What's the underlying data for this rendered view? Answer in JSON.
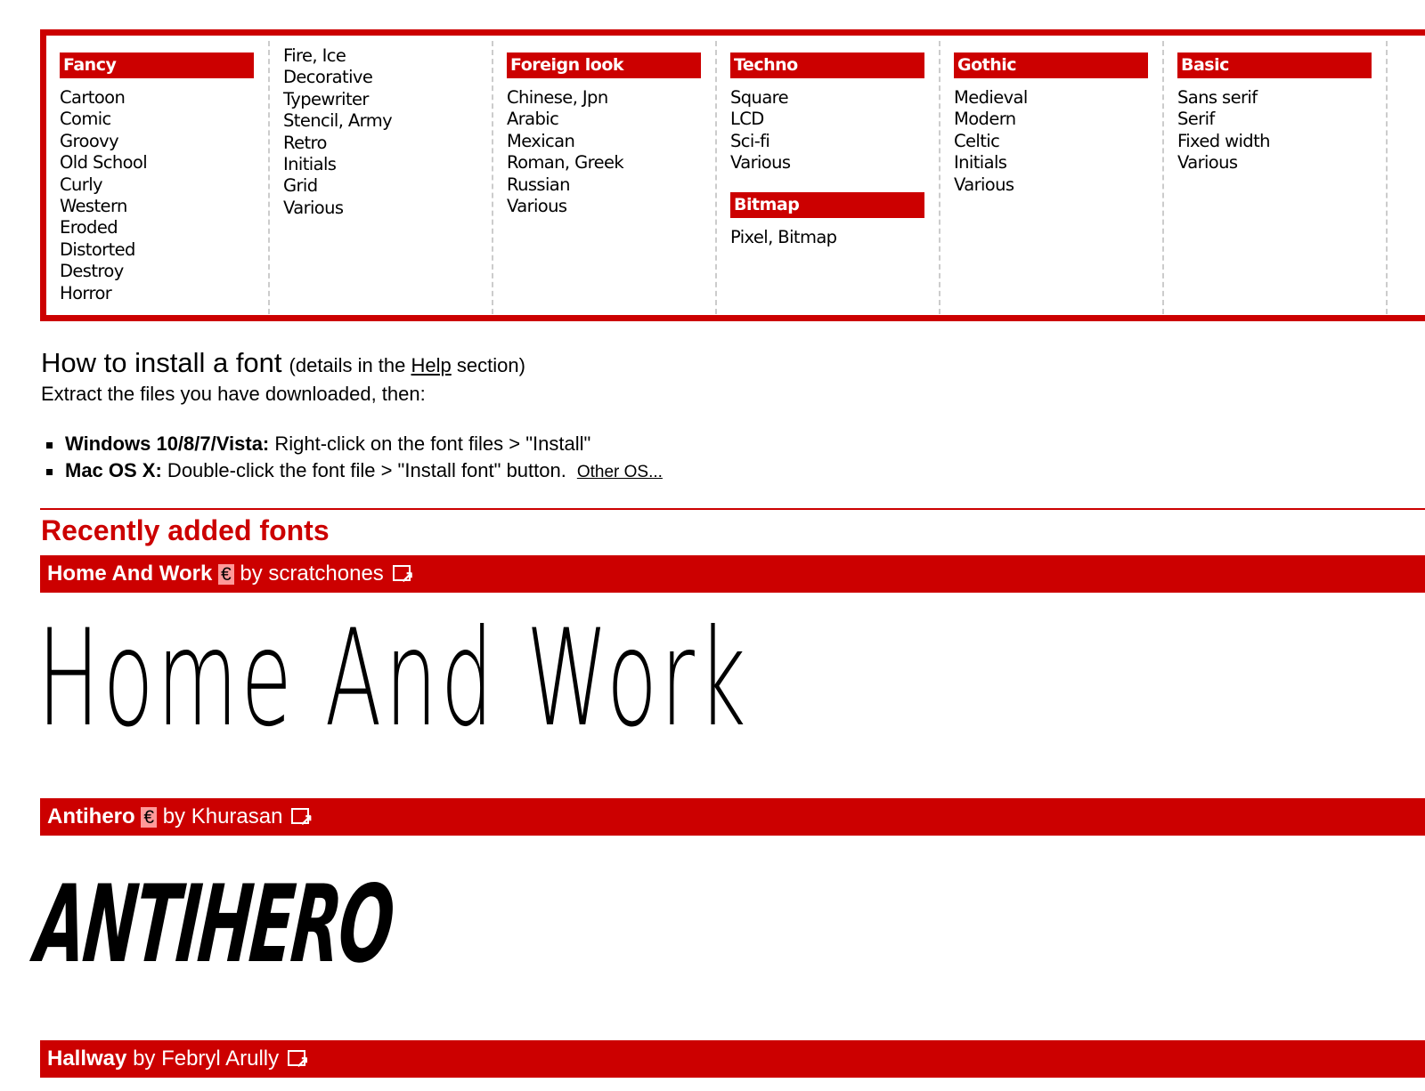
{
  "categories": [
    {
      "title": "Fancy",
      "items": [
        "Cartoon",
        "Comic",
        "Groovy",
        "Old School",
        "Curly",
        "Western",
        "Eroded",
        "Distorted",
        "Destroy",
        "Horror"
      ]
    },
    {
      "title": "",
      "items": [
        "Fire, Ice",
        "Decorative",
        "Typewriter",
        "Stencil, Army",
        "Retro",
        "Initials",
        "Grid",
        "Various"
      ]
    },
    {
      "title": "Foreign look",
      "items": [
        "Chinese, Jpn",
        "Arabic",
        "Mexican",
        "Roman, Greek",
        "Russian",
        "Various"
      ]
    },
    {
      "title": "Techno",
      "items": [
        "Square",
        "LCD",
        "Sci-fi",
        "Various"
      ],
      "title2": "Bitmap",
      "items2": [
        "Pixel, Bitmap"
      ]
    },
    {
      "title": "Gothic",
      "items": [
        "Medieval",
        "Modern",
        "Celtic",
        "Initials",
        "Various"
      ]
    },
    {
      "title": "Basic",
      "items": [
        "Sans serif",
        "Serif",
        "Fixed width",
        "Various"
      ]
    }
  ],
  "install": {
    "title": "How to install a font",
    "details_pre": "(details in the ",
    "help": "Help",
    "details_post": " section)",
    "intro": "Extract the files you have downloaded, then:",
    "windows_label": "Windows 10/8/7/Vista:",
    "windows_text": " Right-click on the font files > \"Install\"",
    "mac_label": "Mac OS X:",
    "mac_text": " Double-click the font file > \"Install font\" button.",
    "other_os": "Other OS..."
  },
  "recent": {
    "title": "Recently added fonts",
    "fonts": [
      {
        "name": "Home And Work",
        "euro": "€",
        "by": "by scratchones",
        "preview": "Home And Work"
      },
      {
        "name": "Antihero",
        "euro": "€",
        "by": "by Khurasan",
        "preview": "ANTIHERO"
      },
      {
        "name": "Hallway",
        "by": "by Febryl Arully"
      }
    ]
  },
  "colors": {
    "accent": "#cc0000",
    "euro_badge": "#ff9999"
  }
}
